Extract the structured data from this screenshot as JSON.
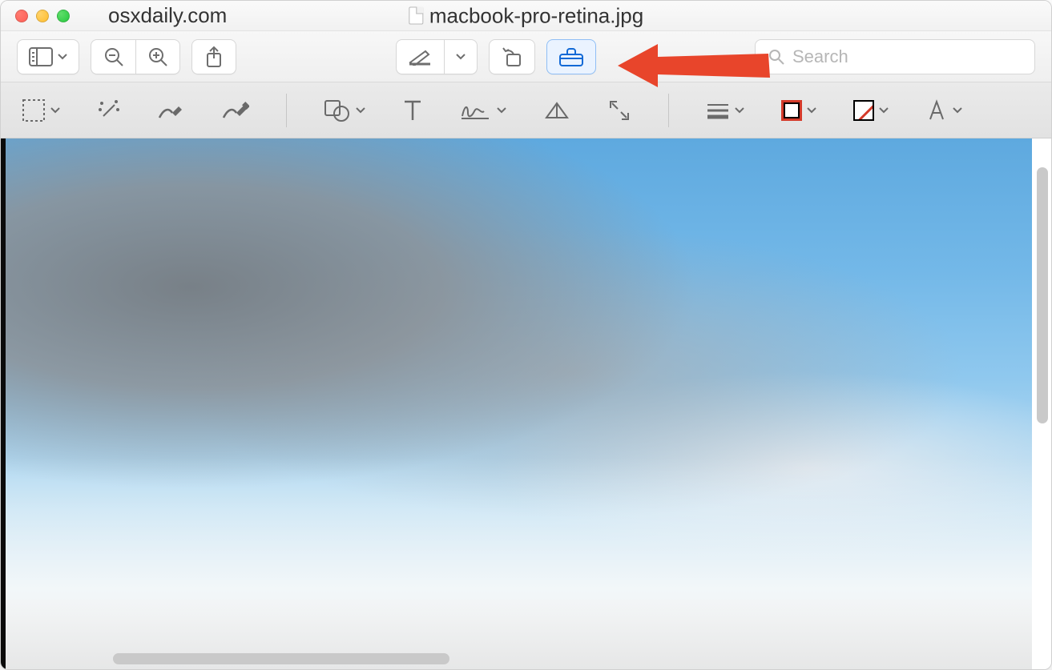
{
  "window": {
    "site_label": "osxdaily.com",
    "filename": "macbook-pro-retina.jpg"
  },
  "toolbar": {
    "sidebar_icon": "sidebar-icon",
    "zoom_out_icon": "zoom-out-icon",
    "zoom_in_icon": "zoom-in-icon",
    "share_icon": "share-icon",
    "highlight_icon": "highlight-icon",
    "rotate_icon": "rotate-left-icon",
    "markup_icon": "toolbox-icon",
    "search_placeholder": "Search"
  },
  "markup": {
    "tools": [
      {
        "name": "selection-tool",
        "icon": "selection-rect-icon",
        "has_menu": true
      },
      {
        "name": "instant-alpha-tool",
        "icon": "magic-wand-icon",
        "has_menu": false
      },
      {
        "name": "draw-tool",
        "icon": "pencil-draw-icon",
        "has_menu": false
      },
      {
        "name": "sketch-tool",
        "icon": "brush-draw-icon",
        "has_menu": false
      },
      {
        "name": "shapes-tool",
        "icon": "shapes-icon",
        "has_menu": true
      },
      {
        "name": "text-tool",
        "icon": "text-icon",
        "has_menu": false
      },
      {
        "name": "sign-tool",
        "icon": "signature-icon",
        "has_menu": true
      },
      {
        "name": "adjust-color-tool",
        "icon": "prism-icon",
        "has_menu": false
      },
      {
        "name": "adjust-size-tool",
        "icon": "resize-icon",
        "has_menu": false
      }
    ],
    "style_tools": [
      {
        "name": "line-style",
        "icon": "line-weight-icon",
        "has_menu": true
      },
      {
        "name": "border-color",
        "icon": "border-color-swatch",
        "has_menu": true,
        "color": "#d43a2a"
      },
      {
        "name": "fill-color",
        "icon": "fill-color-swatch",
        "has_menu": true
      },
      {
        "name": "text-style",
        "icon": "font-style-icon",
        "has_menu": true
      }
    ]
  },
  "annotation": {
    "type": "arrow",
    "color": "#e8452b",
    "points_to": "markup-toolbar-button"
  }
}
